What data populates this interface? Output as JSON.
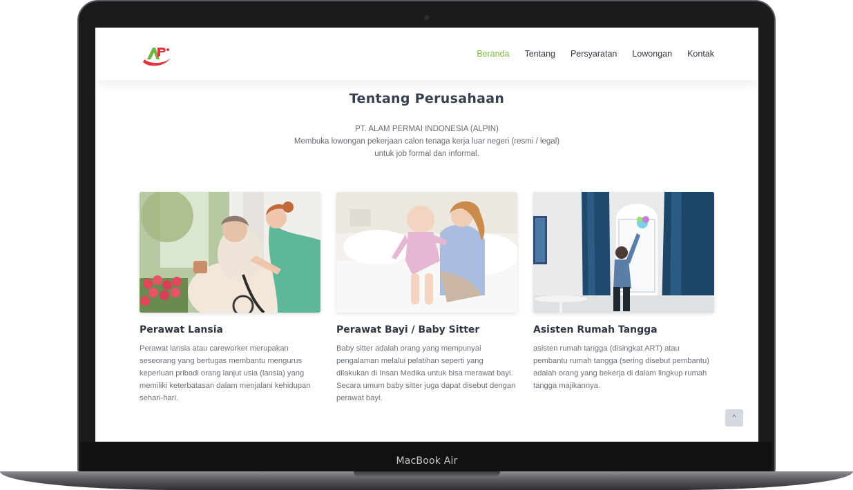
{
  "device": {
    "label": "MacBook Air"
  },
  "header": {
    "logo_icon": "alpin-logo",
    "nav": [
      {
        "label": "Beranda",
        "active": true
      },
      {
        "label": "Tentang",
        "active": false
      },
      {
        "label": "Persyaratan",
        "active": false
      },
      {
        "label": "Lowongan",
        "active": false
      },
      {
        "label": "Kontak",
        "active": false
      }
    ]
  },
  "about": {
    "title": "Tentang Perusahaan",
    "lines": [
      "PT. ALAM PERMAI INDONESIA (ALPIN)",
      "Membuka lowongan pekerjaan calon tenaga kerja luar negeri (resmi / legal)",
      "untuk job formal dan informal."
    ]
  },
  "cards": [
    {
      "title": "Perawat Lansia",
      "text": "Perawat lansia atau careworker merupakan seseorang yang bertugas membantu mengurus keperluan pribadi orang lanjut usia (lansia) yang memiliki keterbatasan dalam menjalani kehidupan sehari-hari."
    },
    {
      "title": "Perawat Bayi / Baby Sitter",
      "text": "Baby sitter adalah orang yang mempunyai pengalaman melalui pelatihan seperti yang dilakukan di Insan Medika untuk bisa merawat bayi. Secara umum baby sitter juga dapat disebut dengan perawat bayi."
    },
    {
      "title": "Asisten Rumah Tangga",
      "text": "asisten rumah tangga (disingkat ART) atau pembantu rumah tangga (sering disebut pembantu) adalah orang yang bekerja di dalam lingkup rumah tangga majikannya."
    }
  ],
  "back_to_top": {
    "icon": "chevron-up-icon",
    "glyph": "^"
  },
  "colors": {
    "accent": "#7bbb3d",
    "logo_red": "#e0363d",
    "logo_green": "#6cb33f",
    "heading": "#37404f",
    "body_text": "#6b7078"
  }
}
